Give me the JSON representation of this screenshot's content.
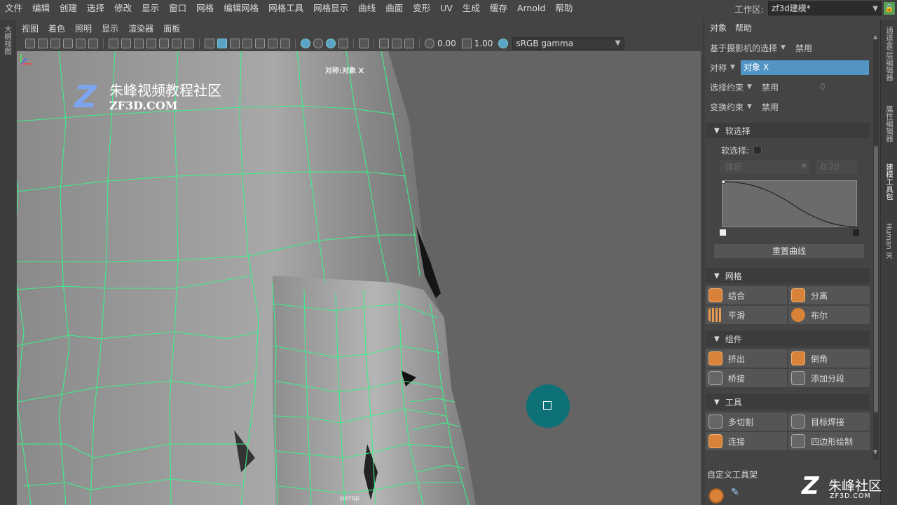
{
  "menubar": {
    "items": [
      "文件",
      "编辑",
      "创建",
      "选择",
      "修改",
      "显示",
      "窗口",
      "网格",
      "编辑网格",
      "网格工具",
      "网格显示",
      "曲线",
      "曲面",
      "变形",
      "UV",
      "生成",
      "缓存",
      "Arnold",
      "帮助"
    ],
    "workspace_label": "工作区:",
    "workspace_value": "zf3d建模*"
  },
  "left_strip": {
    "label": "大纲视图"
  },
  "viewport_menu": {
    "items": [
      "视图",
      "着色",
      "照明",
      "显示",
      "渲染器",
      "面板"
    ]
  },
  "viewport_toolbar": {
    "field1": "0.00",
    "field2": "1.00",
    "color_management": "sRGB gamma"
  },
  "viewport": {
    "symmetry_label": "对称:对象 X",
    "camera_label": "persp",
    "watermark_title": "朱峰视频教程社区",
    "watermark_sub": "ZF3D.COM"
  },
  "right_panel": {
    "menu": [
      "对象",
      "帮助"
    ],
    "camera_select_label": "基于摄影机的选择",
    "camera_select_value": "禁用",
    "symmetry_label": "对称",
    "symmetry_value": "对象 X",
    "select_constraint_label": "选择约束",
    "select_constraint_value": "禁用",
    "select_constraint_num": "0",
    "transform_constraint_label": "变换约束",
    "transform_constraint_value": "禁用",
    "soft_select": {
      "header": "软选择",
      "checkbox_label": "软选择:",
      "volume_label": "体积",
      "falloff_value": "0.20",
      "reset_curve": "重置曲线"
    },
    "mesh": {
      "header": "网格",
      "combine": "结合",
      "separate": "分离",
      "smooth": "平滑",
      "boolean": "布尔"
    },
    "components": {
      "header": "组件",
      "extrude": "挤出",
      "bevel": "倒角",
      "bridge": "桥接",
      "add_divisions": "添加分段"
    },
    "tools": {
      "header": "工具",
      "multi_cut": "多切割",
      "target_weld": "目标焊接",
      "connect": "连接",
      "quad_draw": "四边形绘制"
    },
    "custom_shelf": "自定义工具架"
  },
  "right_tabs": [
    "通道盒/层编辑器",
    "属性编辑器",
    "建模工具包",
    "Human IK"
  ],
  "bottom_watermark": {
    "title": "朱峰社区",
    "sub": "ZF3D.COM"
  }
}
